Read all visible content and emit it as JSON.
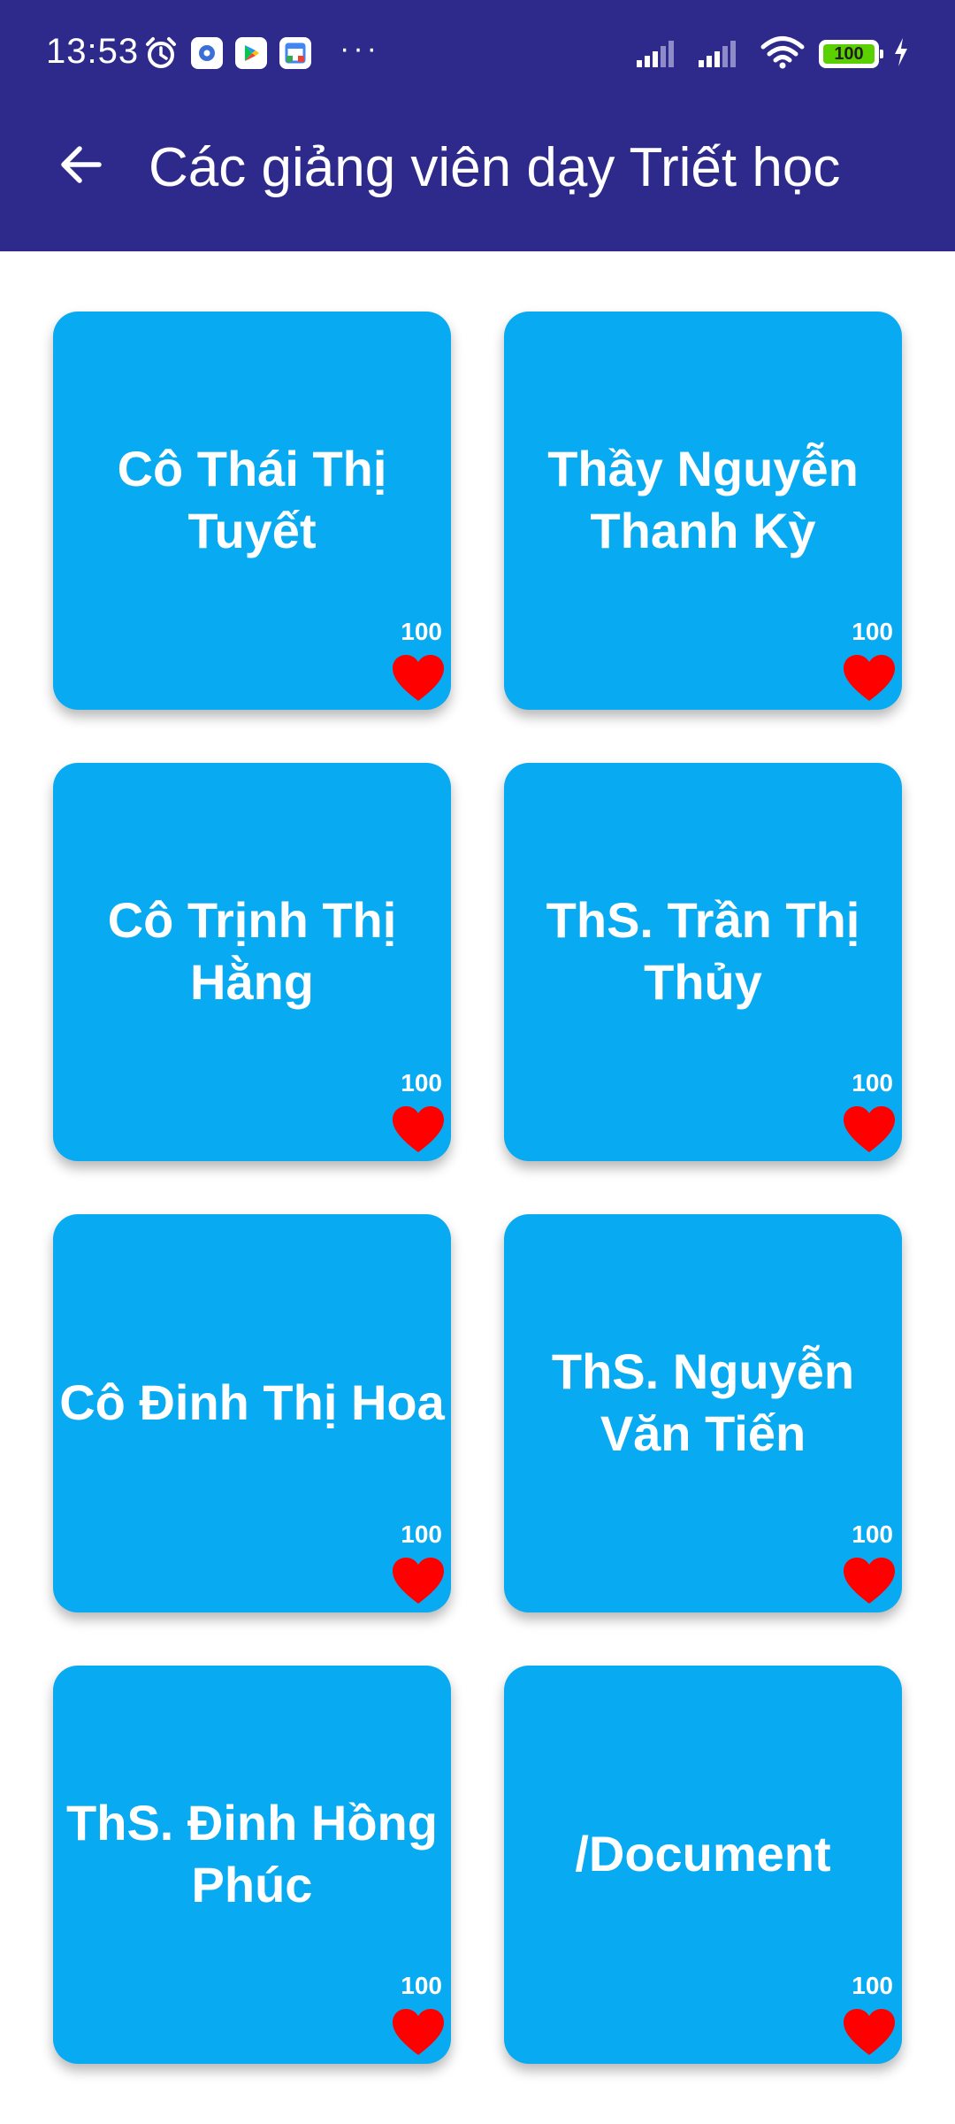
{
  "status_bar": {
    "time": "13:53",
    "battery": "100",
    "icons_left": [
      "alarm-icon",
      "settings-app-icon",
      "play-store-icon",
      "calendar-icon",
      "more-notifications-icon"
    ],
    "icons_right": [
      "signal-icon",
      "signal-icon",
      "wifi-icon",
      "battery-icon",
      "charging-icon"
    ]
  },
  "toolbar": {
    "title": "Các giảng viên dạy Triết học",
    "back_icon": "arrow-left-icon",
    "color": "#2e2a8b"
  },
  "cards": [
    {
      "title": "Cô Thái Thị Tuyết",
      "count": "100"
    },
    {
      "title": "Thầy Nguyễn Thanh Kỳ",
      "count": "100"
    },
    {
      "title": "Cô Trịnh Thị Hằng",
      "count": "100"
    },
    {
      "title": "ThS. Trần Thị Thủy",
      "count": "100"
    },
    {
      "title": "Cô Đinh Thị Hoa",
      "count": "100"
    },
    {
      "title": "ThS. Nguyễn Văn Tiến",
      "count": "100"
    },
    {
      "title": "ThS. Đinh Hồng Phúc",
      "count": "100"
    },
    {
      "title": "/Document",
      "count": "100"
    }
  ],
  "colors": {
    "card": "#08aaf2",
    "heart": "#ff0000",
    "battery_fill": "#5bd000"
  }
}
